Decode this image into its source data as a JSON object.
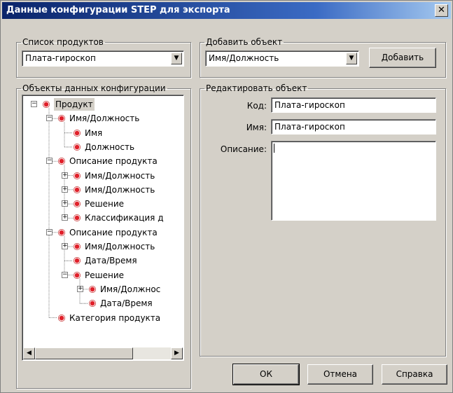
{
  "window": {
    "title": "Данные конфигурации STEP для экспорта",
    "close_glyph": "✕"
  },
  "products": {
    "legend": "Список продуктов",
    "selected": "Плата-гироскоп"
  },
  "add_object": {
    "legend": "Добавить объект",
    "selected": "Имя/Должность",
    "add_label": "Добавить"
  },
  "tree_panel": {
    "legend": "Объекты данных конфигурации",
    "nodes": [
      {
        "label": "Продукт",
        "expander": "−"
      },
      {
        "label": "Имя/Должность",
        "expander": "−"
      },
      {
        "label": "Имя"
      },
      {
        "label": "Должность"
      },
      {
        "label": "Описание продукта",
        "expander": "−"
      },
      {
        "label": "Имя/Должность",
        "expander": "+"
      },
      {
        "label": "Имя/Должность",
        "expander": "+"
      },
      {
        "label": "Решение",
        "expander": "+"
      },
      {
        "label": "Классификация д",
        "expander": "+"
      },
      {
        "label": "Описание продукта",
        "expander": "−"
      },
      {
        "label": "Имя/Должность",
        "expander": "+"
      },
      {
        "label": "Дата/Время"
      },
      {
        "label": "Решение",
        "expander": "−"
      },
      {
        "label": "Имя/Должнос",
        "expander": "+"
      },
      {
        "label": "Дата/Время"
      },
      {
        "label": "Категория продукта"
      }
    ]
  },
  "edit_object": {
    "legend": "Редактировать объект",
    "code_label": "Код:",
    "code_value": "Плата-гироскоп",
    "name_label": "Имя:",
    "name_value": "Плата-гироскоп",
    "desc_label": "Описание:",
    "desc_value": ""
  },
  "buttons": {
    "ok": "ОК",
    "cancel": "Отмена",
    "help": "Справка"
  }
}
